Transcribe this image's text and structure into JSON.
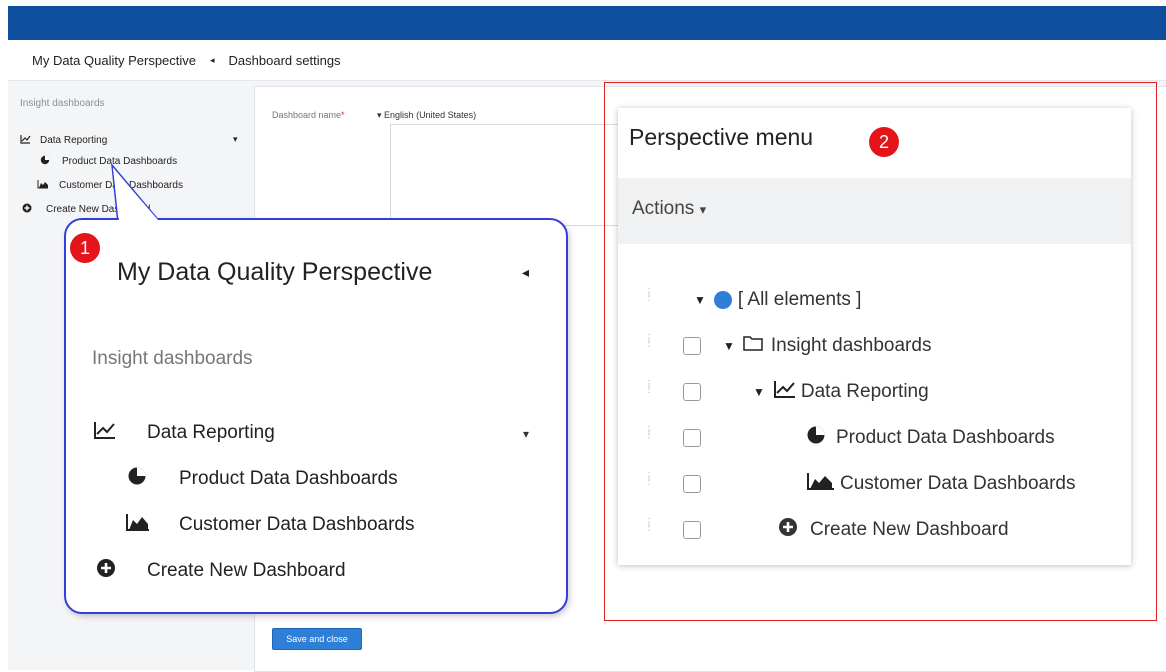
{
  "breadcrumb": {
    "perspective": "My Data Quality Perspective",
    "separator": "◂",
    "page": "Dashboard settings"
  },
  "sidebar": {
    "section": "Insight dashboards",
    "items": [
      {
        "label": "Data Reporting",
        "icon": "line-chart-icon",
        "glyph": "📈"
      },
      {
        "label": "Product Data Dashboards",
        "icon": "pie-chart-icon",
        "glyph": "◕"
      },
      {
        "label": "Customer Data Dashboards",
        "icon": "area-chart-icon",
        "glyph": "▟"
      },
      {
        "label": "Create New Dashboard",
        "icon": "plus-circle-icon",
        "glyph": "⊕"
      }
    ],
    "caret": "▾"
  },
  "form": {
    "name_label": "Dashboard name",
    "required_mark": "*",
    "language": "English (United States)",
    "lang_caret": "▾",
    "save_label": "Save and close"
  },
  "callout1": {
    "badge": "1",
    "title": "My Data Quality Perspective",
    "collapse_glyph": "◂",
    "section": "Insight dashboards",
    "items": [
      {
        "label": "Data Reporting"
      },
      {
        "label": "Product Data Dashboards"
      },
      {
        "label": "Customer Data Dashboards"
      },
      {
        "label": "Create New Dashboard"
      }
    ],
    "caret": "▾"
  },
  "perspective_menu": {
    "badge": "2",
    "title": "Perspective menu",
    "actions_label": "Actions",
    "actions_caret": "▾",
    "rows": [
      {
        "label": "[ All elements ]"
      },
      {
        "label": "Insight dashboards"
      },
      {
        "label": "Data Reporting"
      },
      {
        "label": "Product Data Dashboards"
      },
      {
        "label": "Customer Data Dashboards"
      },
      {
        "label": "Create New Dashboard"
      }
    ]
  },
  "colors": {
    "topbar": "#0d4f9c",
    "callout_border": "#3340d8",
    "badge_red": "#e5141a",
    "highlight_border": "#e02020",
    "primary_button": "#2f7fd8"
  }
}
